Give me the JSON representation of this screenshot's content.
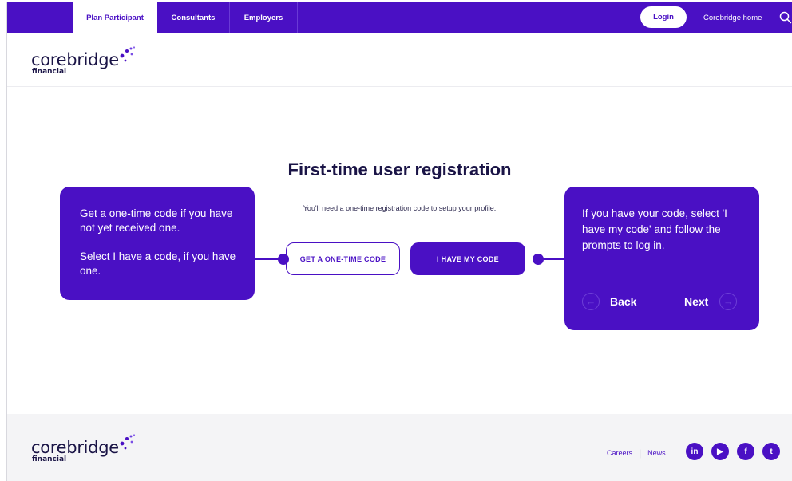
{
  "topnav": {
    "tabs": [
      {
        "label": "Plan Participant",
        "active": true
      },
      {
        "label": "Consultants",
        "active": false
      },
      {
        "label": "Employers",
        "active": false
      }
    ],
    "login_label": "Login",
    "home_label": "Corebridge home",
    "search_icon": "search-icon"
  },
  "brand": {
    "name": "corebridge",
    "sub": "financial",
    "color": "#4a10c4",
    "text_color": "#1a1446"
  },
  "main": {
    "title": "First-time user registration",
    "subtitle": "You'll need a one-time registration code to setup your profile.",
    "buttons": {
      "get_code": "GET A ONE-TIME CODE",
      "have_code": "I HAVE MY CODE"
    }
  },
  "callouts": {
    "left": {
      "line1": "Get a one-time code if you have not yet received one.",
      "line2": "Select I have a code, if you have one."
    },
    "right": {
      "text": "If you have your code, select 'I have my code' and follow the prompts to log in.",
      "back_label": "Back",
      "next_label": "Next"
    }
  },
  "footer": {
    "links": [
      "Careers",
      "News"
    ],
    "separator": "|",
    "social": [
      {
        "icon": "linkedin-icon",
        "glyph": "in"
      },
      {
        "icon": "youtube-icon",
        "glyph": "▶"
      },
      {
        "icon": "facebook-icon",
        "glyph": "f"
      },
      {
        "icon": "twitter-icon",
        "glyph": "t"
      }
    ]
  }
}
